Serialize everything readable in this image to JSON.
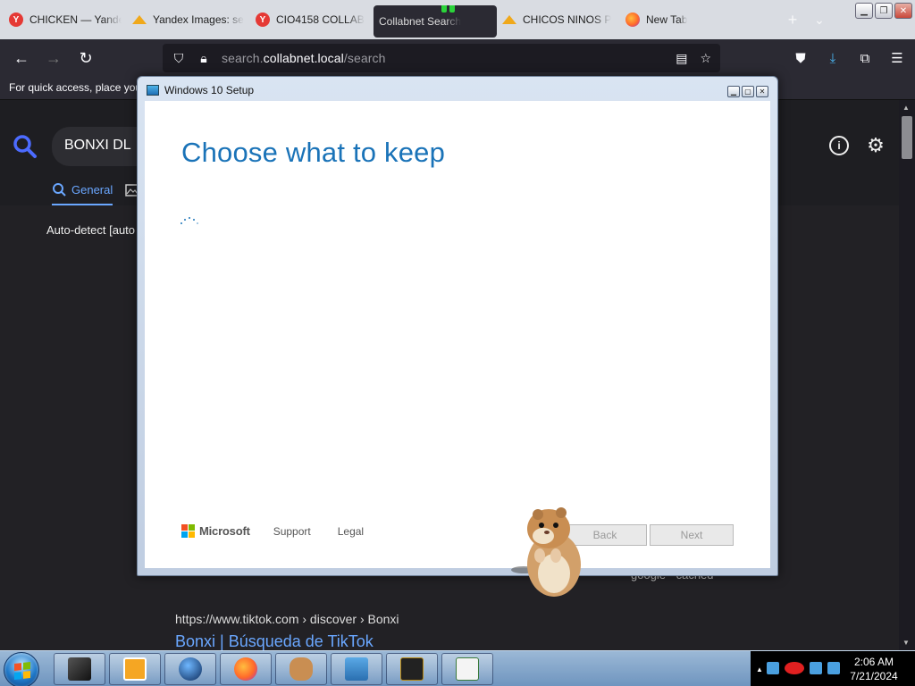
{
  "browser": {
    "tabs": [
      {
        "label": "CHICKEN — Yande",
        "favicon": "yandex-icon"
      },
      {
        "label": "Yandex Images: se",
        "favicon": "yandex-images-icon"
      },
      {
        "label": "CIO4158 COLLAB",
        "favicon": "yandex-icon"
      },
      {
        "label": "Collabnet Search",
        "favicon": "none",
        "active": true
      },
      {
        "label": "CHICOS NINOS P",
        "favicon": "yandex-images-icon"
      },
      {
        "label": "New Tab",
        "favicon": "firefox-icon"
      }
    ],
    "url_prefix": "search.",
    "url_host": "collabnet.local",
    "url_path": "/search",
    "bookmarks_hint": "For quick access, place your"
  },
  "page": {
    "query": "BONXI DL",
    "tab_general": "General",
    "autodetect": "Auto-detect [auto",
    "result_url": "https://www.tiktok.com  › discover › Bonxi",
    "result_title": "Bonxi | Búsqueda de TikTok",
    "result_links": "google   ·   cached"
  },
  "dialog": {
    "title": "Windows 10 Setup",
    "heading": "Choose what to keep",
    "brand": "Microsoft",
    "support": "Support",
    "legal": "Legal",
    "back": "Back",
    "next": "Next"
  },
  "taskbar": {
    "time": "2:06 AM",
    "date": "7/21/2024"
  },
  "colors": {
    "accent_blue": "#1a73b8",
    "link_blue": "#6aa7ff",
    "browser_dark": "#2b2a33"
  }
}
